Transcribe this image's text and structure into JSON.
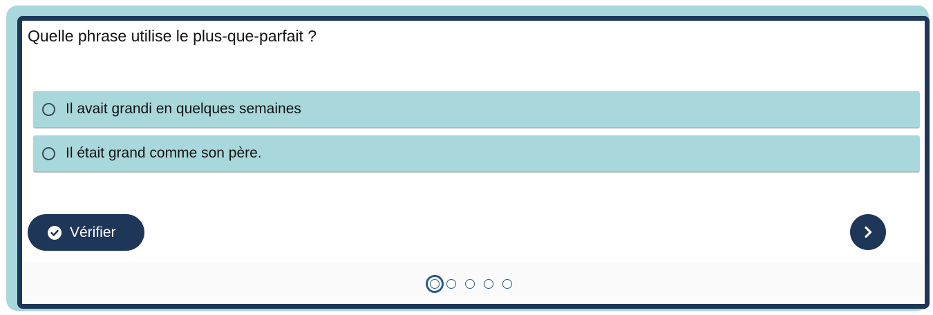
{
  "question": {
    "text": "Quelle phrase utilise le plus-que-parfait ?"
  },
  "options": [
    {
      "label": "Il avait grandi en quelques semaines",
      "selected": false
    },
    {
      "label": "Il était grand comme son père.",
      "selected": false
    }
  ],
  "actions": {
    "verify_label": "Vérifier",
    "verify_icon": "check-circle-icon",
    "next_icon": "chevron-right-icon"
  },
  "pagination": {
    "total_pages": 5,
    "current_page": 1
  },
  "colors": {
    "frame_border": "#1e3658",
    "outer_frame": "#a8d8db",
    "option_background": "#a8d8db",
    "button_background": "#1e3658",
    "pager_dot": "#2a5a8a"
  }
}
